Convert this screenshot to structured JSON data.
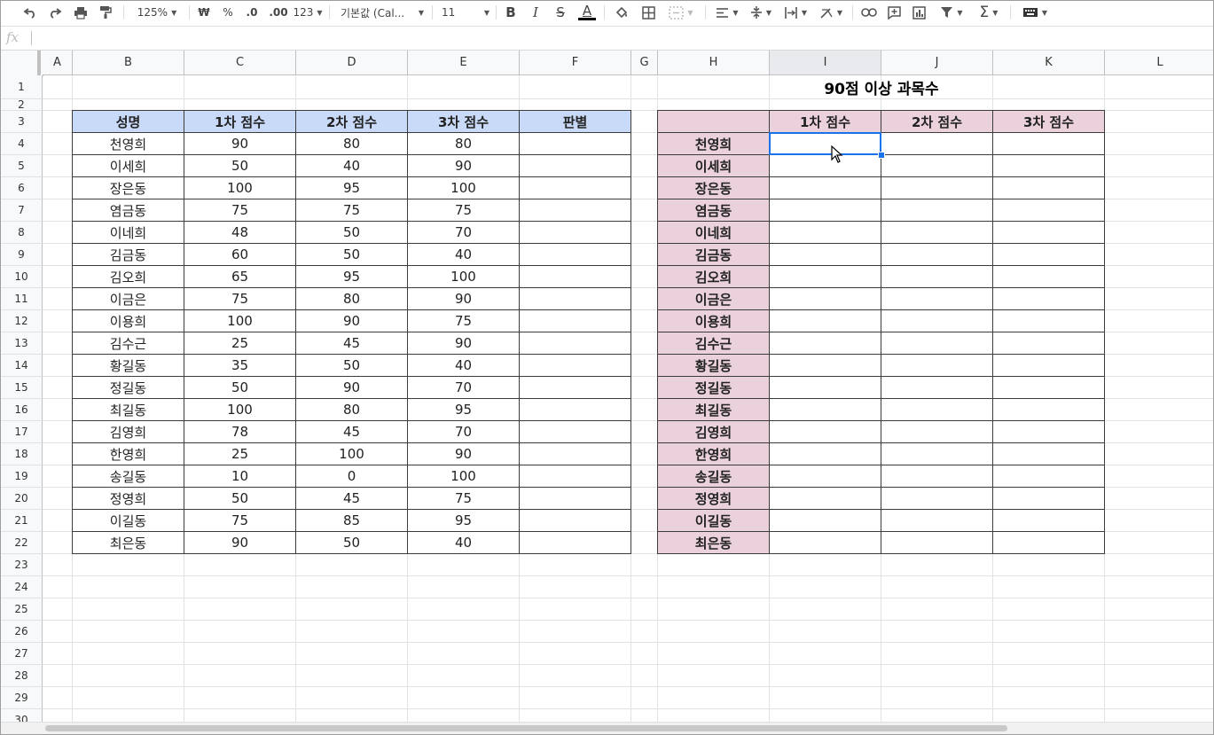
{
  "toolbar": {
    "zoom": "125%",
    "currency": "₩",
    "percent": "%",
    "decimal_decrease": ".0",
    "decimal_increase": ".00",
    "number_format": "123",
    "font_family": "기본값 (Cal...",
    "font_size": "11",
    "bold": "B",
    "italic": "I",
    "strike": "S",
    "text_color": "A",
    "function": "Σ"
  },
  "formula_bar": {
    "fx": "fx",
    "value": ""
  },
  "columns": [
    "A",
    "B",
    "C",
    "D",
    "E",
    "F",
    "G",
    "H",
    "I",
    "J",
    "K",
    "L"
  ],
  "selected_column": "I",
  "rows": [
    "1",
    "2",
    "3",
    "4",
    "5",
    "6",
    "7",
    "8",
    "9",
    "10",
    "11",
    "12",
    "13",
    "14",
    "15",
    "16",
    "17",
    "18",
    "19",
    "20",
    "21",
    "22",
    "23",
    "24",
    "25",
    "26",
    "27",
    "28",
    "29",
    "30"
  ],
  "colors": {
    "blue_header": "#c9daf8",
    "pink_header": "#ead1dc",
    "selection": "#1a73e8"
  },
  "left_table": {
    "headers": [
      "성명",
      "1차 점수",
      "2차 점수",
      "3차 점수",
      "판별"
    ],
    "rows": [
      [
        "천영희",
        "90",
        "80",
        "80",
        ""
      ],
      [
        "이세희",
        "50",
        "40",
        "90",
        ""
      ],
      [
        "장은동",
        "100",
        "95",
        "100",
        ""
      ],
      [
        "염금동",
        "75",
        "75",
        "75",
        ""
      ],
      [
        "이네희",
        "48",
        "50",
        "70",
        ""
      ],
      [
        "김금동",
        "60",
        "50",
        "40",
        ""
      ],
      [
        "김오희",
        "65",
        "95",
        "100",
        ""
      ],
      [
        "이금은",
        "75",
        "80",
        "90",
        ""
      ],
      [
        "이용희",
        "100",
        "90",
        "75",
        ""
      ],
      [
        "김수근",
        "25",
        "45",
        "90",
        ""
      ],
      [
        "황길동",
        "35",
        "50",
        "40",
        ""
      ],
      [
        "정길동",
        "50",
        "90",
        "70",
        ""
      ],
      [
        "최길동",
        "100",
        "80",
        "95",
        ""
      ],
      [
        "김영희",
        "78",
        "45",
        "70",
        ""
      ],
      [
        "한영희",
        "25",
        "100",
        "90",
        ""
      ],
      [
        "송길동",
        "10",
        "0",
        "100",
        ""
      ],
      [
        "정영희",
        "50",
        "45",
        "75",
        ""
      ],
      [
        "이길동",
        "75",
        "85",
        "95",
        ""
      ],
      [
        "최은동",
        "90",
        "50",
        "40",
        ""
      ]
    ]
  },
  "right_table": {
    "title": "90점 이상 과목수",
    "headers": [
      "",
      "1차 점수",
      "2차 점수",
      "3차 점수"
    ],
    "names": [
      "천영희",
      "이세희",
      "장은동",
      "염금동",
      "이네희",
      "김금동",
      "김오희",
      "이금은",
      "이용희",
      "김수근",
      "황길동",
      "정길동",
      "최길동",
      "김영희",
      "한영희",
      "송길동",
      "정영희",
      "이길동",
      "최은동"
    ]
  }
}
